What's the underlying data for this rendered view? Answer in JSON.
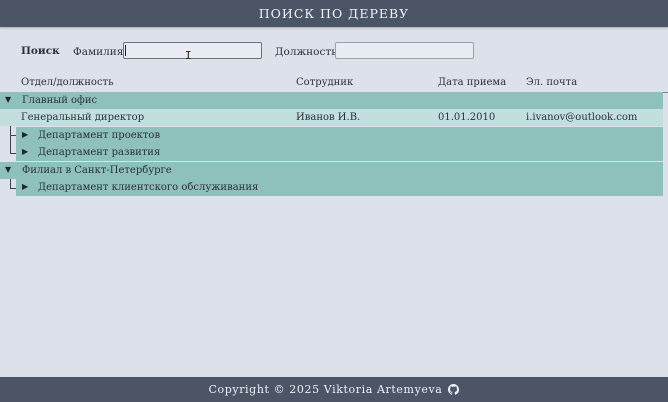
{
  "header": {
    "title": "ПОИСК ПО ДЕРЕВУ"
  },
  "search": {
    "title": "Поиск",
    "surname_label": "Фамилия",
    "surname_value": "",
    "position_label": "Должность",
    "position_value": ""
  },
  "table": {
    "columns": [
      "Отдел/должность",
      "Сотрудник",
      "Дата приема",
      "Эл. почта"
    ],
    "rows": [
      {
        "level": 0,
        "expanded": true,
        "label": "Главный офис"
      },
      {
        "level": 1,
        "label": "Генеральный директор",
        "employee": "Иванов И.В.",
        "hire_date": "01.01.2010",
        "email": "i.ivanov@outlook.com"
      },
      {
        "level": 1,
        "expanded": false,
        "label": "Департамент проектов"
      },
      {
        "level": 1,
        "expanded": false,
        "label": "Департамент развития"
      },
      {
        "level": 0,
        "expanded": true,
        "label": "Филиал в Санкт-Петербурге"
      },
      {
        "level": 1,
        "expanded": false,
        "label": "Департамент клиентского обслуживания"
      }
    ]
  },
  "footer": {
    "text": "Copyright © 2025 Viktoria Artemyeva"
  },
  "icons": {
    "expanded": "triangle-down-icon",
    "collapsed": "triangle-right-icon",
    "github": "github-icon"
  },
  "colors": {
    "header_bg": "#4b5566",
    "row_group": "#8fc1bb",
    "row_selected": "#c3dfdd",
    "page_bg": "#dde1ea"
  }
}
